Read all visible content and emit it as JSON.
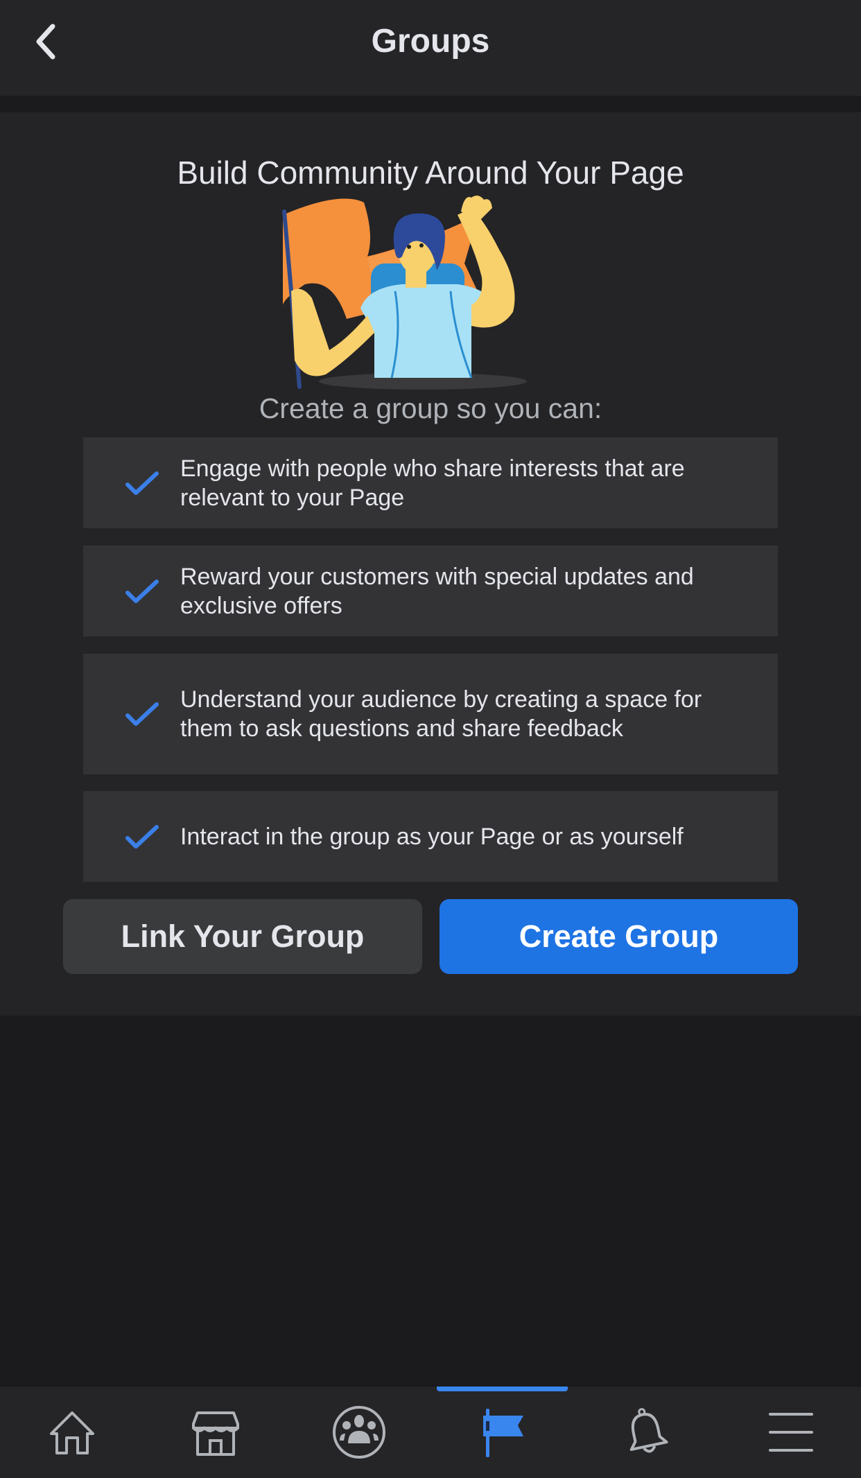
{
  "header": {
    "title": "Groups",
    "back_icon": "chevron-left-icon"
  },
  "content": {
    "headline": "Build Community Around Your Page",
    "illustration": "person-waving-with-flag-illustration",
    "subheadline": "Create a group so you can:",
    "benefits": [
      {
        "icon": "checkmark-icon",
        "text": "Engage with people who share interests that are relevant to your Page"
      },
      {
        "icon": "checkmark-icon",
        "text": "Reward your customers with special updates and exclusive offers"
      },
      {
        "icon": "checkmark-icon",
        "text": "Understand your audience by creating a space for them to ask questions and share feedback"
      },
      {
        "icon": "checkmark-icon",
        "text": "Interact in the group as your Page or as yourself"
      }
    ],
    "buttons": {
      "link_group": "Link Your Group",
      "create_group": "Create Group"
    }
  },
  "tabbar": {
    "active": "pages",
    "tabs": [
      {
        "id": "home",
        "icon": "home-icon"
      },
      {
        "id": "marketplace",
        "icon": "marketplace-icon"
      },
      {
        "id": "groups",
        "icon": "groups-icon"
      },
      {
        "id": "pages",
        "icon": "flag-icon"
      },
      {
        "id": "notifications",
        "icon": "bell-icon"
      },
      {
        "id": "menu",
        "icon": "hamburger-menu-icon"
      }
    ]
  },
  "colors": {
    "accent": "#1f74e4",
    "check": "#3b7fe8",
    "background": "#1b1b1d",
    "panel": "#242426",
    "card": "#333336"
  }
}
